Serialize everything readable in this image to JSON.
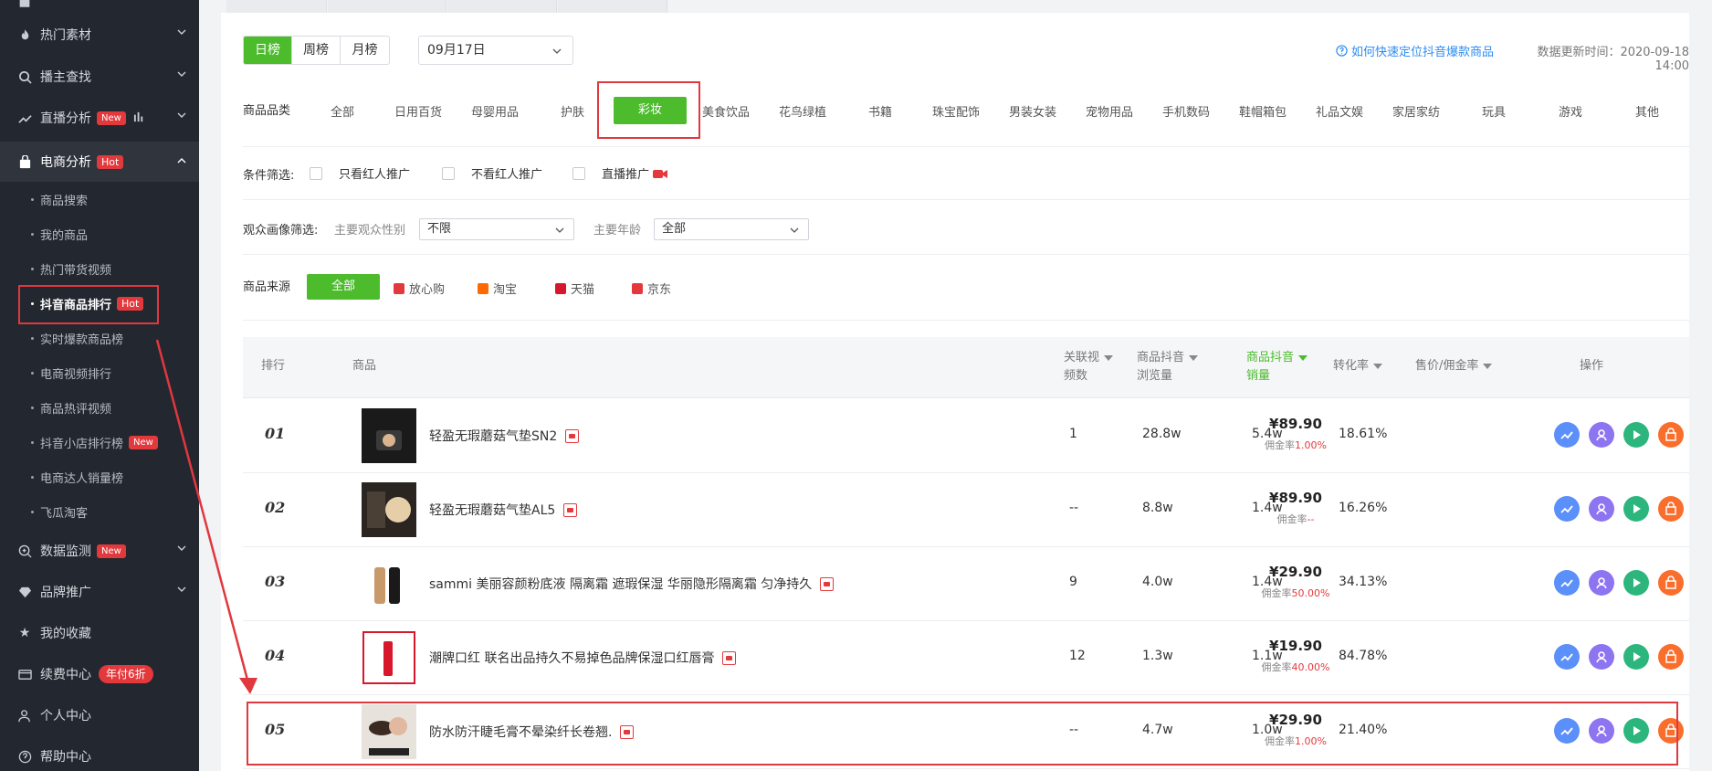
{
  "sidebar": {
    "items": [
      {
        "label": "热门素材",
        "icon": "fire-icon"
      },
      {
        "label": "播主查找",
        "icon": "search-icon"
      },
      {
        "label": "直播分析",
        "icon": "live-icon",
        "badge": "New"
      },
      {
        "label": "电商分析",
        "icon": "bag-icon",
        "badge": "Hot"
      },
      {
        "label": "数据监测",
        "icon": "monitor-icon",
        "badge": "New"
      },
      {
        "label": "品牌推广",
        "icon": "diamond-icon"
      },
      {
        "label": "我的收藏",
        "icon": "star-icon"
      },
      {
        "label": "续费中心",
        "icon": "card-icon",
        "badge": "年付6折"
      },
      {
        "label": "个人中心",
        "icon": "user-icon"
      },
      {
        "label": "帮助中心",
        "icon": "help-icon"
      }
    ],
    "subitems": [
      {
        "label": "商品搜索"
      },
      {
        "label": "我的商品"
      },
      {
        "label": "热门带货视频"
      },
      {
        "label": "抖音商品排行",
        "badge": "Hot"
      },
      {
        "label": "实时爆款商品榜"
      },
      {
        "label": "电商视频排行"
      },
      {
        "label": "商品热评视频"
      },
      {
        "label": "抖音小店排行榜",
        "badge": "New"
      },
      {
        "label": "电商达人销量榜"
      },
      {
        "label": "飞瓜淘客"
      }
    ]
  },
  "toolbar": {
    "periods": [
      "日榜",
      "周榜",
      "月榜"
    ],
    "date": "09月17日",
    "help_link": "如何快速定位抖音爆款商品",
    "update_time": "数据更新时间：2020-09-18 14:00"
  },
  "filters": {
    "category_label": "商品品类",
    "categories": [
      "全部",
      "日用百货",
      "母婴用品",
      "护肤",
      "彩妆",
      "美食饮品",
      "花鸟绿植",
      "书籍",
      "珠宝配饰",
      "男装女装",
      "宠物用品",
      "手机数码",
      "鞋帽箱包",
      "礼品文娱",
      "家居家纺",
      "玩具",
      "游戏",
      "其他"
    ],
    "condition_label": "条件筛选:",
    "conditions": [
      "只看红人推广",
      "不看红人推广",
      "直播推广"
    ],
    "audience_label": "观众画像筛选:",
    "gender_label": "主要观众性别",
    "gender_value": "不限",
    "age_label": "主要年龄",
    "age_value": "全部",
    "source_label": "商品来源",
    "sources": [
      "全部",
      "放心购",
      "淘宝",
      "天猫",
      "京东"
    ]
  },
  "table": {
    "headers": {
      "rank": "排行",
      "product": "商品",
      "videos_l1": "关联视",
      "videos_l2": "频数",
      "views_l1": "商品抖音",
      "views_l2": "浏览量",
      "sales_l1": "商品抖音",
      "sales_l2": "销量",
      "conversion": "转化率",
      "price": "售价/佣金率",
      "ops": "操作"
    },
    "rows": [
      {
        "rank": "01",
        "name": "轻盈无瑕蘑菇气垫SN2",
        "videos": "1",
        "views": "28.8w",
        "sales": "5.4w",
        "conversion": "18.61%",
        "price": "¥89.90",
        "comm_label": "佣金率",
        "comm": "1.00%"
      },
      {
        "rank": "02",
        "name": "轻盈无瑕蘑菇气垫AL5",
        "videos": "--",
        "views": "8.8w",
        "sales": "1.4w",
        "conversion": "16.26%",
        "price": "¥89.90",
        "comm_label": "佣金率",
        "comm": "--"
      },
      {
        "rank": "03",
        "name": "sammi 美丽容颜粉底液 隔离霜 遮瑕保湿 华丽隐形隔离霜 匀净持久",
        "videos": "9",
        "views": "4.0w",
        "sales": "1.4w",
        "conversion": "34.13%",
        "price": "¥29.90",
        "comm_label": "佣金率",
        "comm": "50.00%"
      },
      {
        "rank": "04",
        "name": "潮牌口红 联名出品持久不易掉色品牌保湿口红唇膏",
        "videos": "12",
        "views": "1.3w",
        "sales": "1.1w",
        "conversion": "84.78%",
        "price": "¥19.90",
        "comm_label": "佣金率",
        "comm": "40.00%"
      },
      {
        "rank": "05",
        "name": "防水防汗睫毛膏不晕染纤长卷翘.",
        "videos": "--",
        "views": "4.7w",
        "sales": "1.0w",
        "conversion": "21.40%",
        "price": "¥29.90",
        "comm_label": "佣金率",
        "comm": "1.00%"
      }
    ]
  },
  "colors": {
    "accent": "#4cbb2c",
    "highlight": "#e0383e",
    "sidebar": "#23272f",
    "link": "#2d8cf0"
  }
}
